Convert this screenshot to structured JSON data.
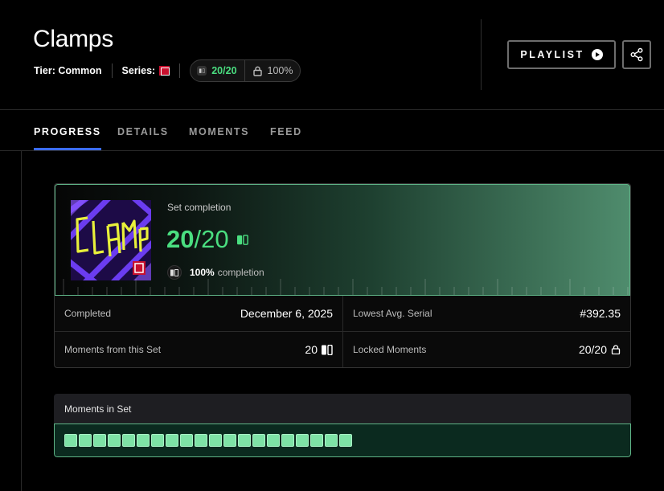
{
  "header": {
    "title": "Clamps",
    "tier_label": "Tier:",
    "tier_value": "Common",
    "series_label": "Series:",
    "owned_count": "20/20",
    "locked_percent": "100%",
    "playlist_button": "PLAYLIST"
  },
  "tabs": [
    {
      "label": "PROGRESS",
      "active": true
    },
    {
      "label": "DETAILS",
      "active": false
    },
    {
      "label": "MOMENTS",
      "active": false
    },
    {
      "label": "FEED",
      "active": false
    }
  ],
  "set_card": {
    "label": "Set completion",
    "owned": "20",
    "total": "/20",
    "completion_percent": "100%",
    "completion_text": "completion",
    "stats": {
      "completed_label": "Completed",
      "completed_value": "December 6, 2025",
      "lowest_serial_label": "Lowest Avg. Serial",
      "lowest_serial_value": "#392.35",
      "from_set_label": "Moments from this Set",
      "from_set_value": "20",
      "locked_label": "Locked Moments",
      "locked_value": "20/20"
    }
  },
  "moments_in_set": {
    "title": "Moments in Set",
    "count": 20,
    "owned": 20
  },
  "colors": {
    "accent_green": "#4ade80",
    "tab_underline": "#3b6cf6",
    "moment_square": "#7ee2a6"
  },
  "icons": [
    "play-icon",
    "share-icon",
    "lock-icon",
    "moment-card-icon",
    "series-badge-icon"
  ]
}
